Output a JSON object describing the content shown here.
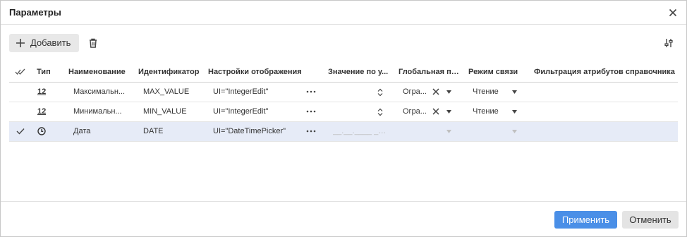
{
  "dialog": {
    "title": "Параметры",
    "close_icon": "close-icon"
  },
  "toolbar": {
    "add_label": "Добавить",
    "add_icon": "plus-icon",
    "delete_icon": "trash-icon",
    "settings_icon": "column-settings-icon"
  },
  "grid": {
    "columns": [
      "Тип",
      "Наименование",
      "Идентификатор",
      "Настройки отображения",
      "Значение по у...",
      "Глобальная пе...",
      "Режим связи",
      "Фильтрация атрибутов справочника"
    ],
    "rows": [
      {
        "type": "12",
        "name": "Максимальн...",
        "identifier": "MAX_VALUE",
        "display_settings": "UI=\"IntegerEdit\"",
        "default_value": "",
        "global_param": "Огра...",
        "link_mode": "Чтение",
        "selected": false
      },
      {
        "type": "12",
        "name": "Минимальн...",
        "identifier": "MIN_VALUE",
        "display_settings": "UI=\"IntegerEdit\"",
        "default_value": "",
        "global_param": "Огра...",
        "link_mode": "Чтение",
        "selected": false
      },
      {
        "type": "clock-icon",
        "name": "Дата",
        "identifier": "DATE",
        "display_settings": "UI=\"DateTimePicker\"",
        "default_value_placeholder": "__.__.____ __:__",
        "global_param": "",
        "link_mode": "",
        "selected": true
      }
    ]
  },
  "footer": {
    "apply_label": "Применить",
    "cancel_label": "Отменить"
  },
  "colors": {
    "accent": "#4a8fe7",
    "selected_row": "#e6ebf7"
  }
}
